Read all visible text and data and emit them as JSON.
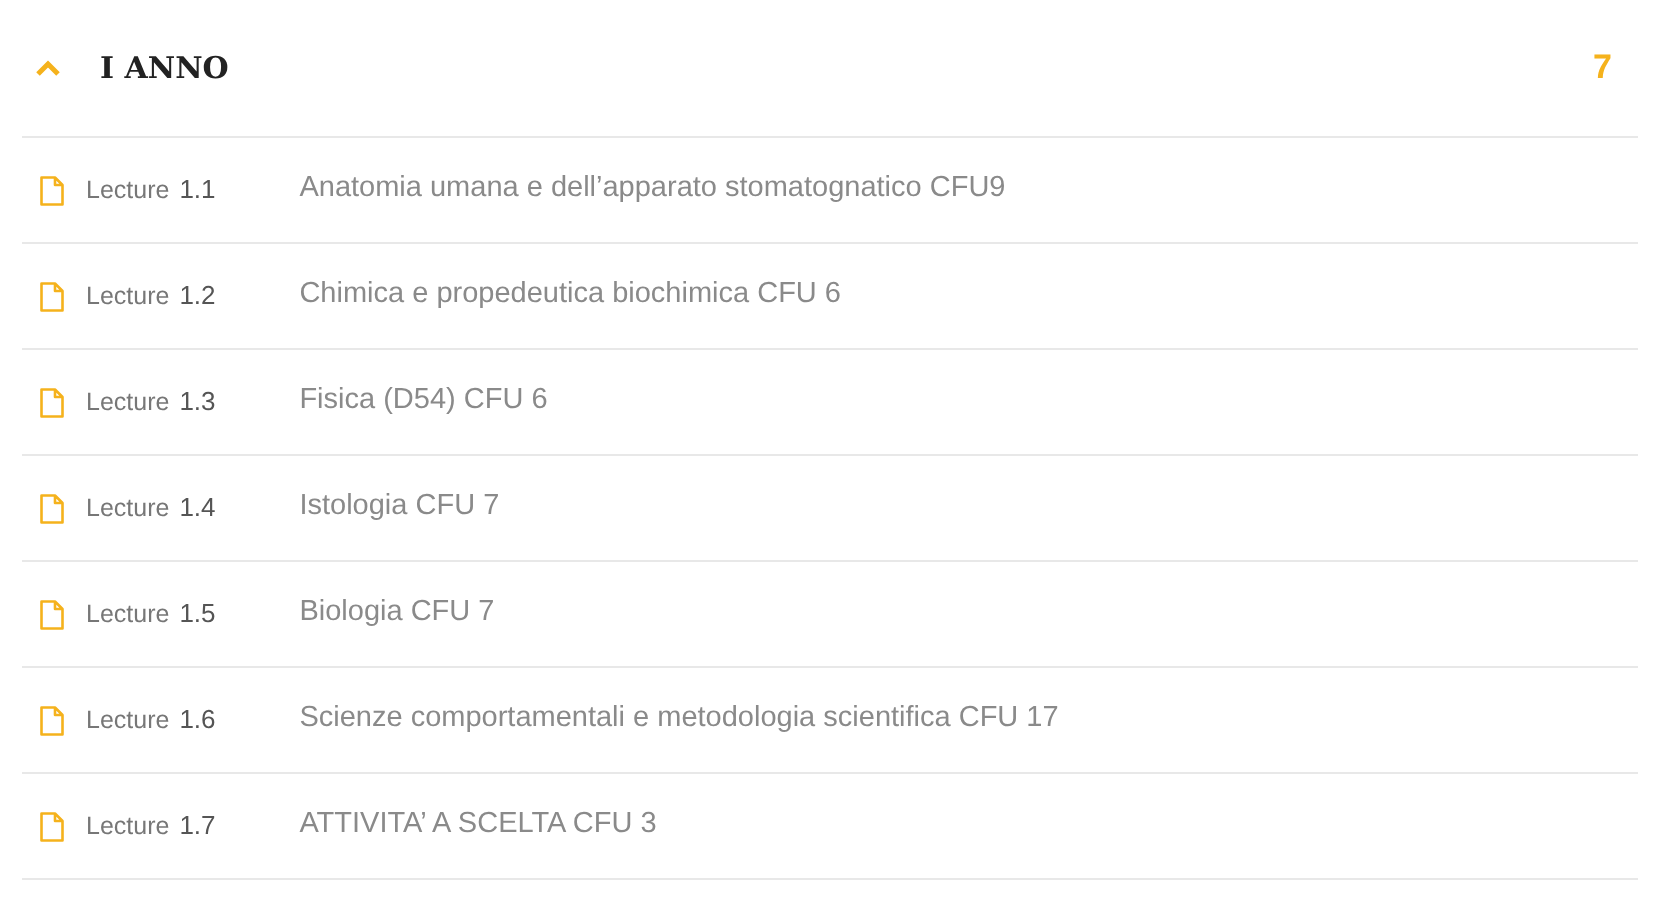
{
  "section": {
    "title": "I ANNO",
    "count": "7",
    "expanded": true
  },
  "lectures": [
    {
      "label": "Lecture",
      "number": "1.1",
      "title": "Anatomia umana e dell’apparato stomatognatico CFU9"
    },
    {
      "label": "Lecture",
      "number": "1.2",
      "title": "Chimica e propedeutica biochimica CFU 6"
    },
    {
      "label": "Lecture",
      "number": "1.3",
      "title": "Fisica (D54) CFU 6"
    },
    {
      "label": "Lecture",
      "number": "1.4",
      "title": "Istologia CFU 7"
    },
    {
      "label": "Lecture",
      "number": "1.5",
      "title": "Biologia CFU 7"
    },
    {
      "label": "Lecture",
      "number": "1.6",
      "title": "Scienze comportamentali e metodologia scientifica CFU 17"
    },
    {
      "label": "Lecture",
      "number": "1.7",
      "title": "ATTIVITA’ A SCELTA CFU 3"
    }
  ]
}
